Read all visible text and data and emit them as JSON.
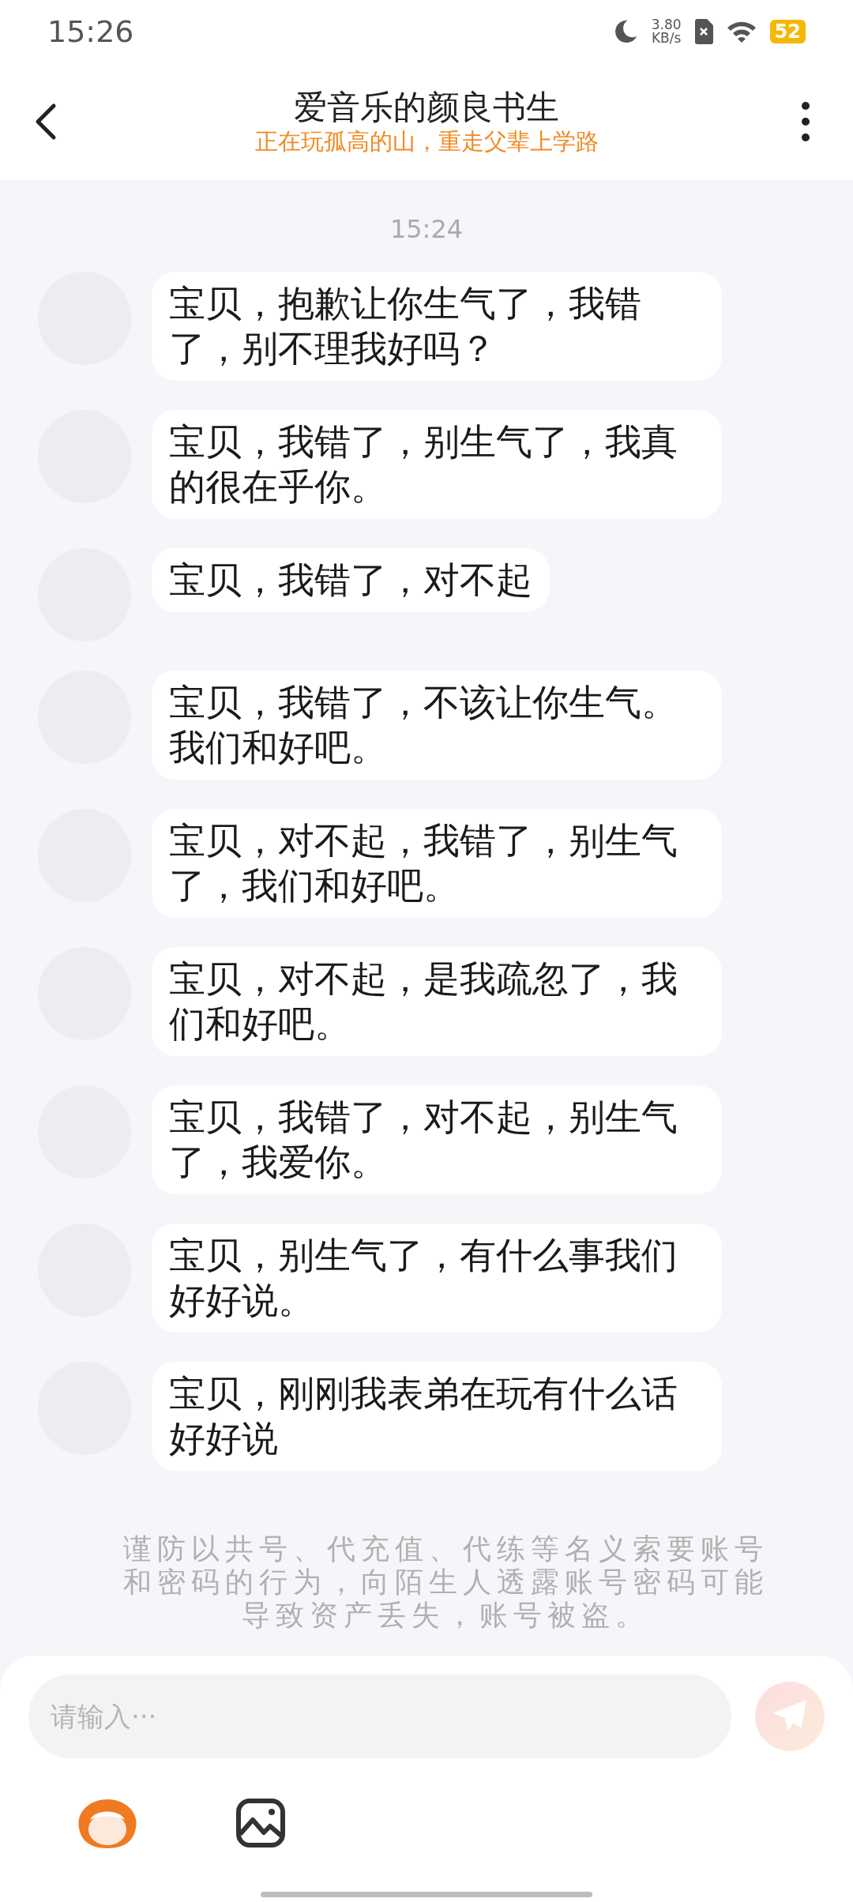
{
  "status_bar": {
    "time": "15:26",
    "net_speed": "3.80",
    "net_unit": "KB/s",
    "battery": "52"
  },
  "header": {
    "title": "爱音乐的颜良书生",
    "subtitle": "正在玩孤高的山，重走父辈上学路"
  },
  "timestamp": "15:24",
  "messages": [
    {
      "text": "宝贝，抱歉让你生气了，我错了，别不理我好吗？"
    },
    {
      "text": "宝贝，我错了，别生气了，我真的很在乎你。"
    },
    {
      "text": "宝贝，我错了，对不起"
    },
    {
      "text": "宝贝，我错了，不该让你生气。我们和好吧。"
    },
    {
      "text": "宝贝，对不起，我错了，别生气了，我们和好吧。"
    },
    {
      "text": "宝贝，对不起，是我疏忽了，我们和好吧。"
    },
    {
      "text": "宝贝，我错了，对不起，别生气了，我爱你。"
    },
    {
      "text": "宝贝，别生气了，有什么事我们好好说。"
    },
    {
      "text": "宝贝，刚刚我表弟在玩有什么话好好说"
    }
  ],
  "notice": "谨防以共号、代充值、代练等名义索要账号和密码的行为，向陌生人透露账号密码可能导致资产丢失，账号被盗。",
  "input": {
    "placeholder": "请输入···"
  },
  "send_button": {
    "disabled": true
  }
}
